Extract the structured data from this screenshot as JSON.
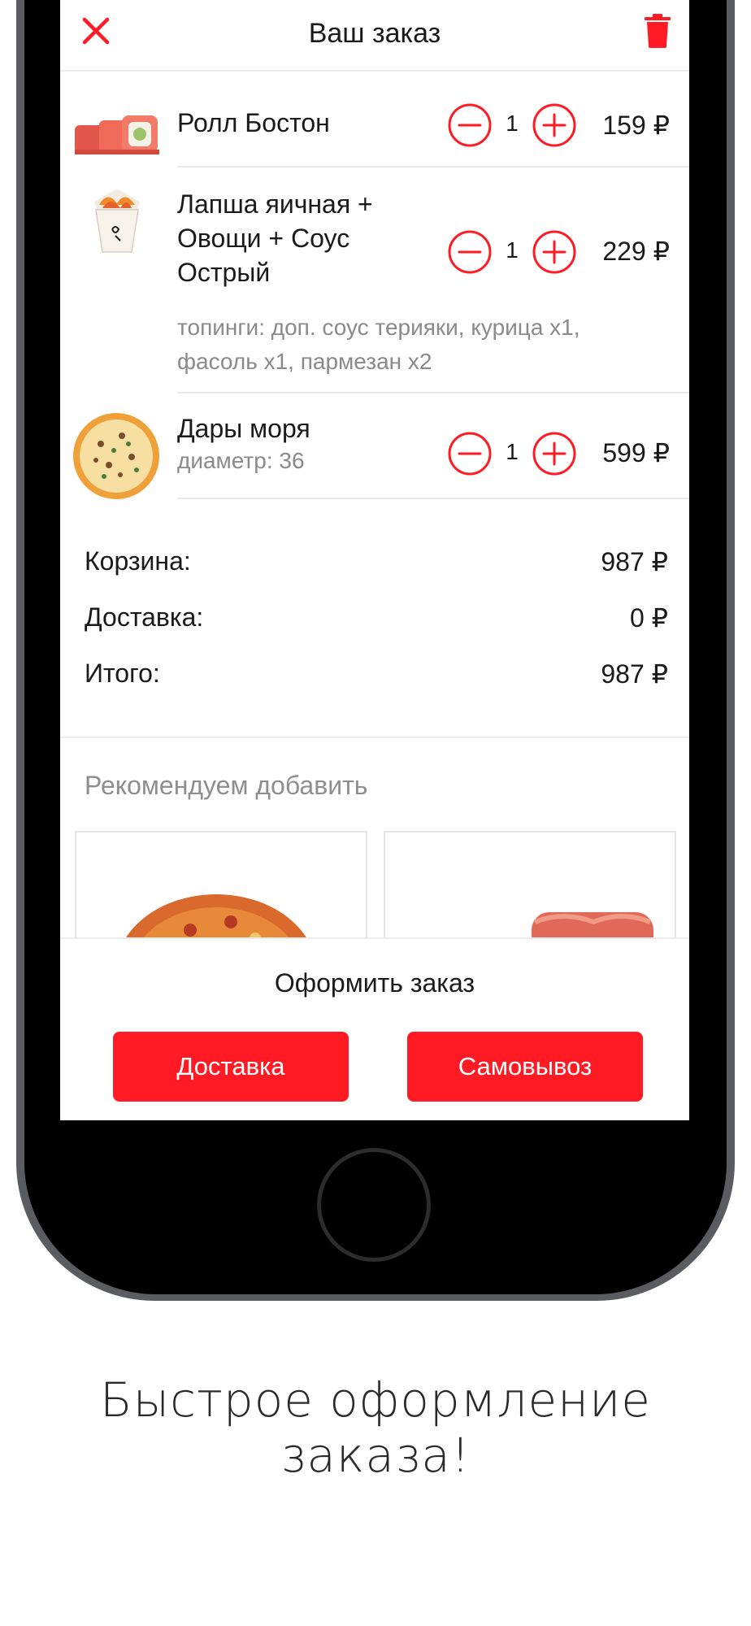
{
  "header": {
    "title": "Ваш заказ",
    "close_icon": "close-icon",
    "trash_icon": "trash-icon"
  },
  "cart_items": [
    {
      "name": "Ролл Бостон",
      "details": "",
      "quantity": "1",
      "price": "159 ₽",
      "thumb": "sushi-roll"
    },
    {
      "name": "Лапша яичная + Овощи + Соус Острый",
      "details": "топинги: доп. соус терияки, курица х1, фасоль х1, пармезан х2",
      "quantity": "1",
      "price": "229 ₽",
      "thumb": "noodle-box"
    },
    {
      "name": "Дары моря",
      "details": "диаметр: 36",
      "quantity": "1",
      "price": "599 ₽",
      "thumb": "pizza"
    }
  ],
  "totals": {
    "cart_label": "Корзина:",
    "cart_value": "987 ₽",
    "delivery_label": "Доставка:",
    "delivery_value": "0 ₽",
    "total_label": "Итого:",
    "total_value": "987 ₽"
  },
  "recommend": {
    "title": "Рекомендуем добавить"
  },
  "checkout": {
    "title": "Оформить заказ",
    "delivery_button": "Доставка",
    "pickup_button": "Самовывоз"
  },
  "tagline": "Быстрое оформление заказа!",
  "colors": {
    "accent": "#ff1a24",
    "text": "#1a1a1a",
    "muted": "#8a8a8a",
    "frame": "#5a5c60"
  }
}
